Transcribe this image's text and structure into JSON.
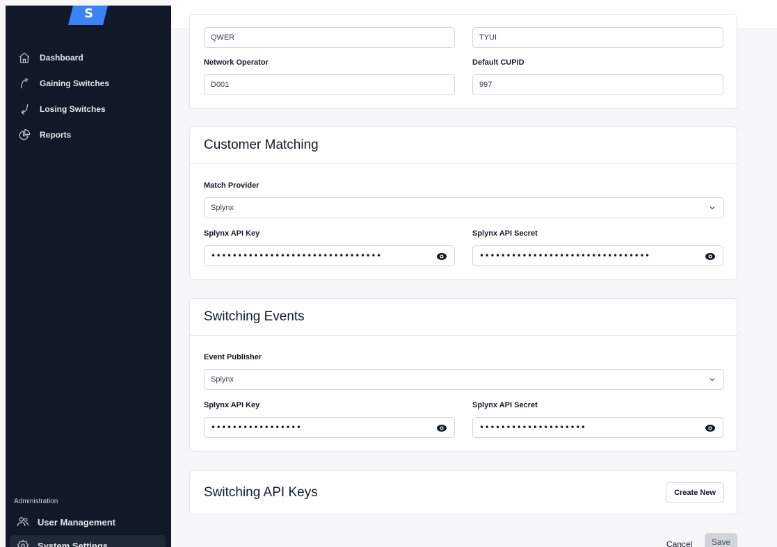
{
  "app": {
    "logo_letter": "S",
    "accent": "#3b82f6"
  },
  "sidebar": {
    "items": [
      {
        "label": "Dashboard",
        "icon": "home-icon"
      },
      {
        "label": "Gaining Switches",
        "icon": "arrow-up-icon"
      },
      {
        "label": "Losing Switches",
        "icon": "arrow-down-icon"
      },
      {
        "label": "Reports",
        "icon": "pie-chart-icon"
      }
    ],
    "admin_label": "Administration",
    "admin_items": [
      {
        "label": "User Management",
        "icon": "users-icon"
      },
      {
        "label": "System Settings",
        "icon": "gear-icon"
      }
    ]
  },
  "general": {
    "field1_value": "QWER",
    "field2_value": "TYUI",
    "network_operator_label": "Network Operator",
    "network_operator_value": "D001",
    "default_cupid_label": "Default CUPID",
    "default_cupid_value": "997"
  },
  "customer_matching": {
    "title": "Customer Matching",
    "match_provider_label": "Match Provider",
    "match_provider_value": "Splynx",
    "api_key_label": "Splynx API Key",
    "api_key_value": "••••••••••••••••••••••••••••••••",
    "api_secret_label": "Splynx API Secret",
    "api_secret_value": "••••••••••••••••••••••••••••••••"
  },
  "switching_events": {
    "title": "Switching Events",
    "event_publisher_label": "Event Publisher",
    "event_publisher_value": "Splynx",
    "api_key_label": "Splynx API Key",
    "api_key_value": "•••••••••••••••••",
    "api_secret_label": "Splynx API Secret",
    "api_secret_value": "••••••••••••••••••••"
  },
  "api_keys": {
    "title": "Switching API Keys",
    "create_label": "Create New"
  },
  "footer": {
    "cancel_label": "Cancel",
    "save_label": "Save"
  }
}
